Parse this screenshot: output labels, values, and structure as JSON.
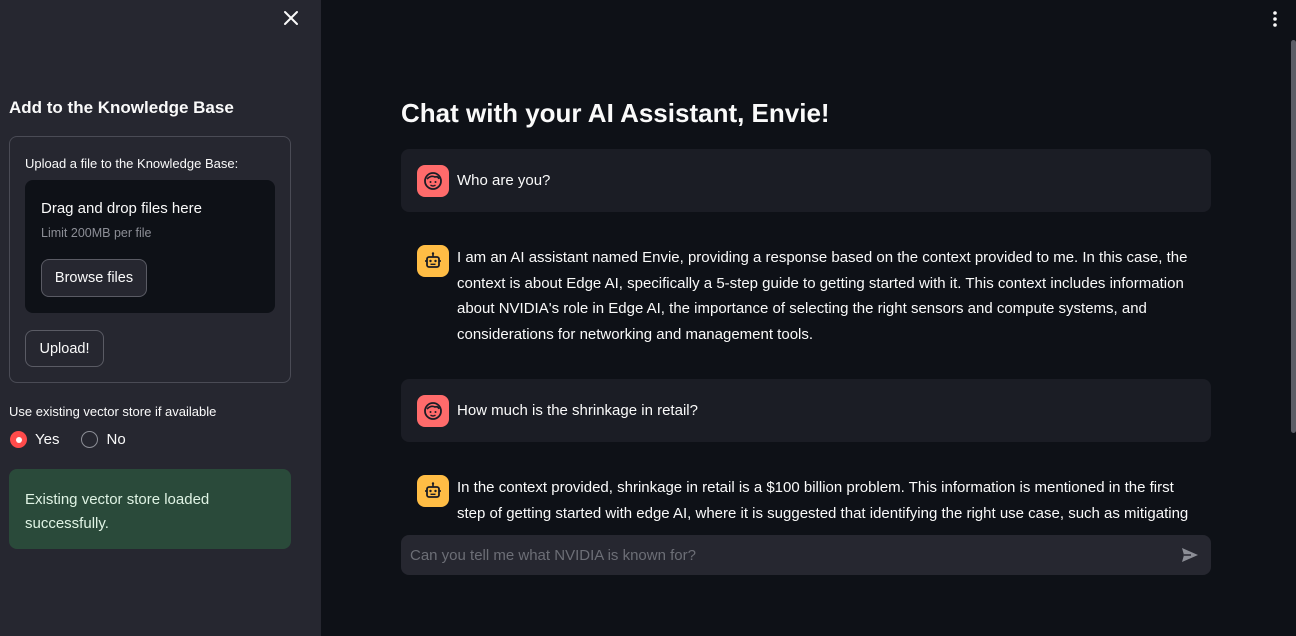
{
  "sidebar": {
    "title": "Add to the Knowledge Base",
    "upload_label": "Upload a file to the Knowledge Base:",
    "dropzone_title": "Drag and drop files here",
    "dropzone_limit": "Limit 200MB per file",
    "browse_label": "Browse files",
    "upload_button": "Upload!",
    "radio_label": "Use existing vector store if available",
    "radio_options": [
      "Yes",
      "No"
    ],
    "radio_selected": "Yes",
    "success_message": "Existing vector store loaded successfully."
  },
  "main": {
    "title": "Chat with your AI Assistant, Envie!",
    "messages": [
      {
        "role": "user",
        "text": "Who are you?"
      },
      {
        "role": "assistant",
        "text": "I am an AI assistant named Envie, providing a response based on the context provided to me. In this case, the context is about Edge AI, specifically a 5-step guide to getting started with it. This context includes information about NVIDIA's role in Edge AI, the importance of selecting the right sensors and compute systems, and considerations for networking and management tools."
      },
      {
        "role": "user",
        "text": "How much is the shrinkage in retail?"
      },
      {
        "role": "assistant",
        "text": "In the context provided, shrinkage in retail is a $100 billion problem. This information is mentioned in the first step of getting started with edge AI, where it is suggested that identifying the right use case, such as mitigating"
      }
    ],
    "input_placeholder": "Can you tell me what NVIDIA is known for?"
  },
  "colors": {
    "sidebar_bg": "#262730",
    "main_bg": "#0e1117",
    "user_avatar": "#ff6b6b",
    "assistant_avatar": "#ffbd45",
    "success_bg": "#2a4a3a",
    "accent": "#ff4b4b"
  },
  "icons": {
    "close": "close-icon",
    "menu": "kebab-menu-icon",
    "send": "send-icon",
    "user_avatar": "face-icon",
    "assistant_avatar": "robot-icon"
  }
}
